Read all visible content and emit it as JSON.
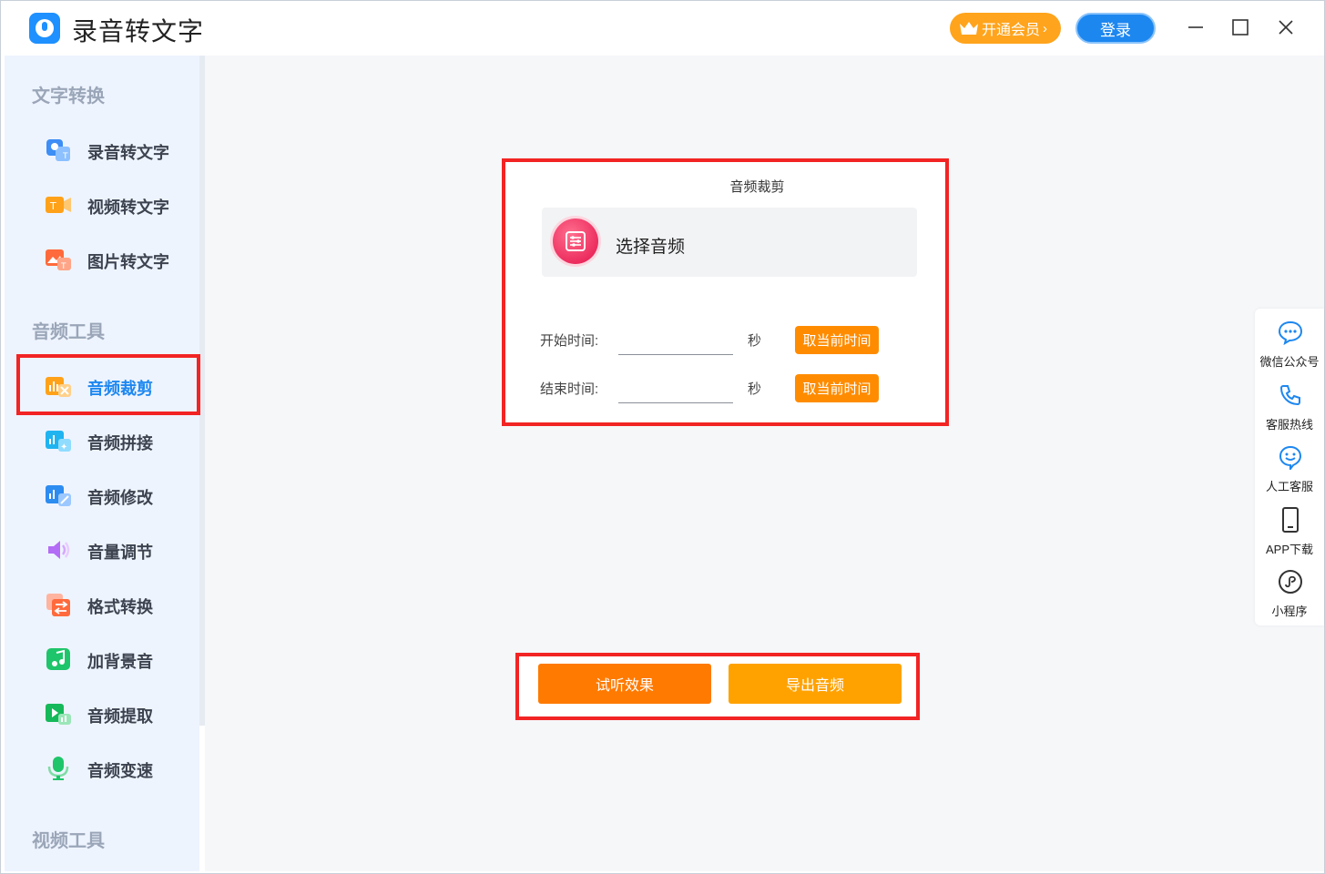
{
  "app": {
    "title": "录音转文字"
  },
  "header": {
    "vip_label": "开通会员",
    "login_label": "登录"
  },
  "sidebar": {
    "sections": [
      {
        "title": "文字转换"
      },
      {
        "title": "音频工具"
      },
      {
        "title": "视频工具"
      }
    ],
    "items": [
      {
        "label": "录音转文字",
        "icon": "record-to-text-icon"
      },
      {
        "label": "视频转文字",
        "icon": "video-to-text-icon"
      },
      {
        "label": "图片转文字",
        "icon": "image-to-text-icon"
      },
      {
        "label": "音频裁剪",
        "icon": "audio-trim-icon",
        "active": true
      },
      {
        "label": "音频拼接",
        "icon": "audio-merge-icon"
      },
      {
        "label": "音频修改",
        "icon": "audio-edit-icon"
      },
      {
        "label": "音量调节",
        "icon": "volume-icon"
      },
      {
        "label": "格式转换",
        "icon": "format-convert-icon"
      },
      {
        "label": "加背景音",
        "icon": "music-note-icon"
      },
      {
        "label": "音频提取",
        "icon": "audio-extract-icon"
      },
      {
        "label": "音频变速",
        "icon": "microphone-icon"
      }
    ]
  },
  "panel": {
    "title": "音频裁剪",
    "select_label": "选择音频",
    "start_label": "开始时间:",
    "end_label": "结束时间:",
    "start_value": "",
    "end_value": "",
    "seconds_unit": "秒",
    "current_time_button": "取当前时间"
  },
  "actions": {
    "preview": "试听效果",
    "export": "导出音频"
  },
  "right_bar": [
    {
      "label": "微信公众号",
      "icon": "chat-bubble-icon"
    },
    {
      "label": "客服热线",
      "icon": "phone-icon"
    },
    {
      "label": "人工客服",
      "icon": "smiley-chat-icon"
    },
    {
      "label": "APP下载",
      "icon": "mobile-phone-icon"
    },
    {
      "label": "小程序",
      "icon": "mini-program-icon"
    }
  ],
  "colors": {
    "brand_blue": "#1d87f0",
    "vip_orange": "#ffa41c",
    "button_orange": "#ff8c00",
    "highlight_red": "#f22424",
    "sidebar_bg": "#eef4fe"
  }
}
